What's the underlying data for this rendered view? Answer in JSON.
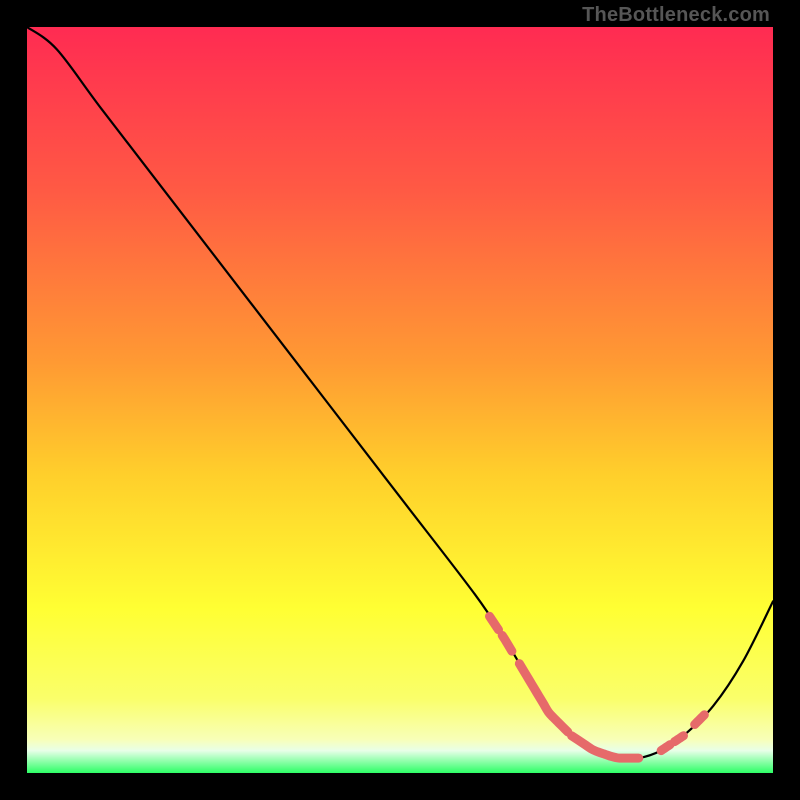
{
  "watermark": "TheBottleneck.com",
  "gradient": {
    "stops": [
      {
        "offset": 0.0,
        "color": "#ff2b52"
      },
      {
        "offset": 0.22,
        "color": "#ff5a44"
      },
      {
        "offset": 0.45,
        "color": "#ff9a33"
      },
      {
        "offset": 0.6,
        "color": "#ffcf2b"
      },
      {
        "offset": 0.78,
        "color": "#ffff33"
      },
      {
        "offset": 0.9,
        "color": "#faff6a"
      },
      {
        "offset": 0.955,
        "color": "#f8ffb8"
      },
      {
        "offset": 0.97,
        "color": "#e8ffe8"
      },
      {
        "offset": 1.0,
        "color": "#2dff66"
      }
    ]
  },
  "chart_data": {
    "type": "line",
    "title": "",
    "xlabel": "",
    "ylabel": "",
    "xlim": [
      0,
      100
    ],
    "ylim": [
      0,
      100
    ],
    "series": [
      {
        "name": "bottleneck-curve",
        "x": [
          0,
          4,
          10,
          20,
          30,
          40,
          50,
          60,
          64,
          67,
          70,
          73,
          76,
          79,
          82,
          85,
          88,
          92,
          96,
          100
        ],
        "y": [
          100,
          97,
          89,
          76,
          63,
          50,
          37,
          24,
          18,
          13,
          8,
          5,
          3,
          2,
          2,
          3,
          5,
          9,
          15,
          23
        ]
      }
    ],
    "highlight_segments": [
      {
        "x": [
          62,
          63.2
        ],
        "y": [
          21.5,
          19.6
        ]
      },
      {
        "x": [
          63.7,
          65.0
        ],
        "y": [
          18.8,
          16.8
        ]
      },
      {
        "x": [
          66.0,
          72.5
        ],
        "y": [
          15.2,
          6.0
        ]
      },
      {
        "x": [
          73.0,
          82.0
        ],
        "y": [
          5.2,
          2.2
        ]
      },
      {
        "x": [
          85.0,
          86.2
        ],
        "y": [
          3.3,
          4.3
        ]
      },
      {
        "x": [
          86.8,
          88.0
        ],
        "y": [
          4.9,
          5.8
        ]
      },
      {
        "x": [
          89.5,
          90.8
        ],
        "y": [
          7.2,
          8.5
        ]
      }
    ]
  }
}
